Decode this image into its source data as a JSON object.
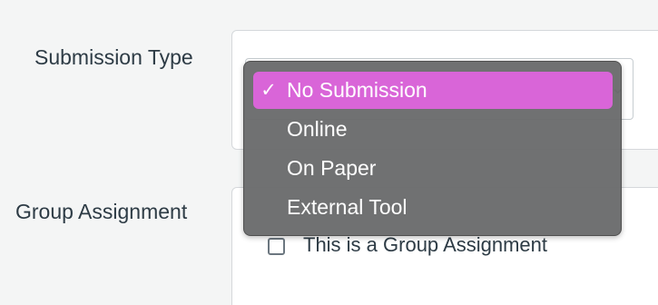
{
  "form": {
    "submission_type": {
      "label": "Submission Type",
      "selected_value": "No Submission",
      "options": [
        {
          "label": "No Submission",
          "selected": true,
          "check": "✓"
        },
        {
          "label": "Online",
          "selected": false,
          "check": ""
        },
        {
          "label": "On Paper",
          "selected": false,
          "check": ""
        },
        {
          "label": "External Tool",
          "selected": false,
          "check": ""
        }
      ],
      "chevron_icon": "chevron-down-icon",
      "highlight_color": "#d965d8"
    },
    "group_assignment": {
      "label": "Group Assignment",
      "checkbox_label": "This is a Group Assignment",
      "checked": false
    }
  }
}
